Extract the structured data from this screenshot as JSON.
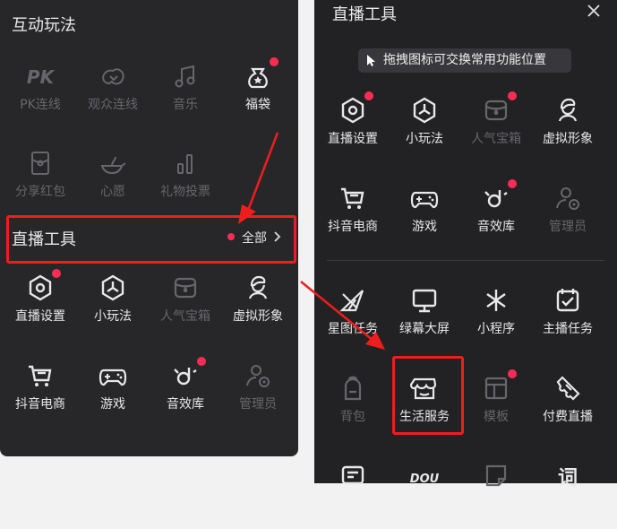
{
  "left": {
    "section1_title": "互动玩法",
    "section1_items": [
      {
        "label": "PK连线",
        "icon": "pk-icon",
        "active": false,
        "dot": false
      },
      {
        "label": "观众连线",
        "icon": "audience-link-icon",
        "active": false,
        "dot": false
      },
      {
        "label": "音乐",
        "icon": "music-icon",
        "active": false,
        "dot": false
      },
      {
        "label": "福袋",
        "icon": "lucky-bag-icon",
        "active": true,
        "dot": true
      },
      {
        "label": "分享红包",
        "icon": "red-envelope-icon",
        "active": false,
        "dot": false
      },
      {
        "label": "心愿",
        "icon": "wish-lamp-icon",
        "active": false,
        "dot": false
      },
      {
        "label": "礼物投票",
        "icon": "gift-vote-icon",
        "active": false,
        "dot": false
      }
    ],
    "section2_title": "直播工具",
    "all_label": "全部",
    "section2_items": [
      {
        "label": "直播设置",
        "icon": "hexagon-settings-icon",
        "active": true,
        "dot": true
      },
      {
        "label": "小玩法",
        "icon": "mini-game-icon",
        "active": true,
        "dot": false
      },
      {
        "label": "人气宝箱",
        "icon": "treasure-box-icon",
        "active": false,
        "dot": false
      },
      {
        "label": "虚拟形象",
        "icon": "avatar-icon",
        "active": true,
        "dot": false
      },
      {
        "label": "抖音电商",
        "icon": "shopping-cart-icon",
        "active": true,
        "dot": false
      },
      {
        "label": "游戏",
        "icon": "gamepad-icon",
        "active": true,
        "dot": false
      },
      {
        "label": "音效库",
        "icon": "sound-effect-icon",
        "active": true,
        "dot": true
      },
      {
        "label": "管理员",
        "icon": "admin-icon",
        "active": false,
        "dot": false
      }
    ]
  },
  "right": {
    "title": "直播工具",
    "hint": "拖拽图标可交换常用功能位置",
    "items_top": [
      {
        "label": "直播设置",
        "icon": "hexagon-settings-icon",
        "active": true,
        "dot": true
      },
      {
        "label": "小玩法",
        "icon": "mini-game-icon",
        "active": true,
        "dot": false
      },
      {
        "label": "人气宝箱",
        "icon": "treasure-box-icon",
        "active": false,
        "dot": true
      },
      {
        "label": "虚拟形象",
        "icon": "avatar-icon",
        "active": true,
        "dot": false
      },
      {
        "label": "抖音电商",
        "icon": "shopping-cart-icon",
        "active": true,
        "dot": false
      },
      {
        "label": "游戏",
        "icon": "gamepad-icon",
        "active": true,
        "dot": false
      },
      {
        "label": "音效库",
        "icon": "sound-effect-icon",
        "active": true,
        "dot": true
      },
      {
        "label": "管理员",
        "icon": "admin-icon",
        "active": false,
        "dot": false
      }
    ],
    "items_bottom": [
      {
        "label": "星图任务",
        "icon": "star-map-icon",
        "active": true,
        "dot": false
      },
      {
        "label": "绿幕大屏",
        "icon": "green-screen-icon",
        "active": true,
        "dot": false
      },
      {
        "label": "小程序",
        "icon": "mini-program-icon",
        "active": true,
        "dot": false
      },
      {
        "label": "主播任务",
        "icon": "calendar-task-icon",
        "active": true,
        "dot": false
      },
      {
        "label": "背包",
        "icon": "backpack-icon",
        "active": false,
        "dot": false
      },
      {
        "label": "生活服务",
        "icon": "store-icon",
        "active": true,
        "dot": false
      },
      {
        "label": "模板",
        "icon": "template-icon",
        "active": false,
        "dot": true
      },
      {
        "label": "付费直播",
        "icon": "ticket-icon",
        "active": true,
        "dot": false
      },
      {
        "label": "",
        "icon": "message-card-icon",
        "active": true,
        "dot": false
      },
      {
        "label": "",
        "icon": "dou-plus-icon",
        "active": true,
        "dot": false
      },
      {
        "label": "",
        "icon": "sticker-icon",
        "active": false,
        "dot": false
      },
      {
        "label": "",
        "icon": "word-icon",
        "active": true,
        "dot": false
      }
    ]
  },
  "colors": {
    "accent": "#fe2c55",
    "annotation": "#ef1d1d",
    "panel": "#27272a"
  }
}
